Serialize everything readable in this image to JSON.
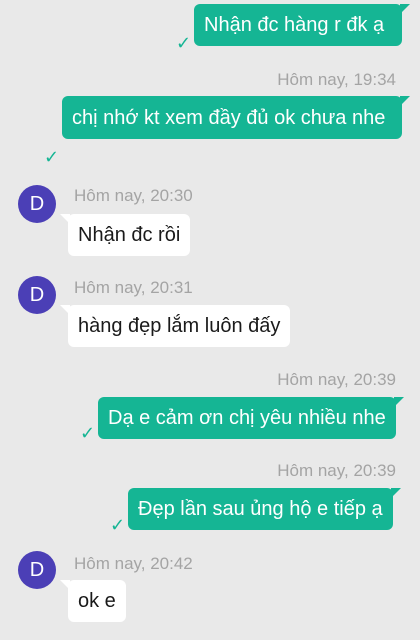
{
  "contact": {
    "avatar_initial": "D"
  },
  "icons": {
    "sent_check": "check-icon"
  },
  "colors": {
    "outgoing": "#15b594",
    "incoming": "#ffffff",
    "avatar": "#4b3fb6",
    "background": "#e9e9e9"
  },
  "messages": [
    {
      "direction": "out",
      "text": "Nhận đc hàng r đk ạ"
    },
    {
      "direction": "out",
      "time": "Hôm nay, 19:34",
      "text": "chị nhớ kt xem đầy đủ ok chưa nhe"
    },
    {
      "direction": "in",
      "time": "Hôm nay, 20:30",
      "text": "Nhận đc rồi"
    },
    {
      "direction": "in",
      "time": "Hôm nay, 20:31",
      "text": "hàng đẹp lắm luôn đấy"
    },
    {
      "direction": "out",
      "time": "Hôm nay, 20:39",
      "text": "Dạ e cảm ơn chị yêu nhiều nhe"
    },
    {
      "direction": "out",
      "time": "Hôm nay, 20:39",
      "text": "Đẹp lần sau ủng hộ e tiếp ạ"
    },
    {
      "direction": "in",
      "time": "Hôm nay, 20:42",
      "text": "ok e"
    }
  ]
}
